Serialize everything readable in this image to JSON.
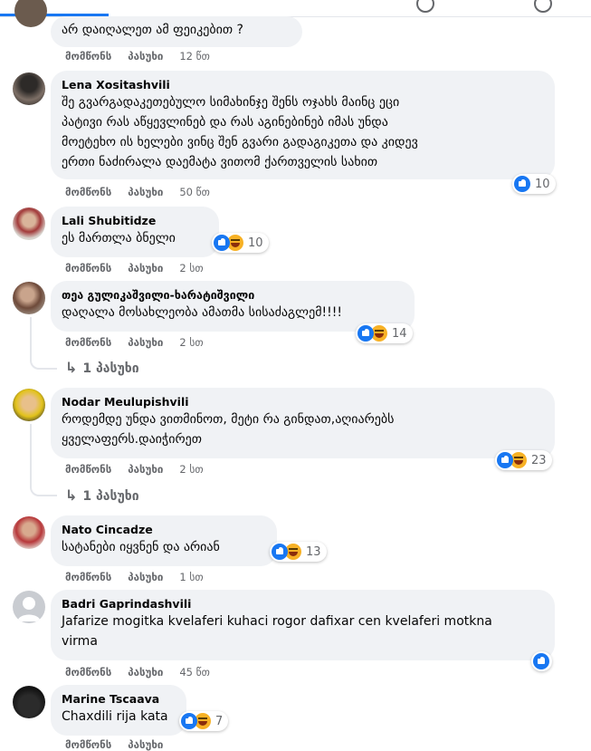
{
  "colors": {
    "accent": "#1877f2",
    "bubble": "#f0f2f5",
    "meta": "#65676b"
  },
  "labels": {
    "like": "მომწონს",
    "reply": "პასუხი"
  },
  "comments": [
    {
      "name": "",
      "text": "არ დაიღალეთ ამ ფეიკებით ?",
      "time": "12 წთ",
      "reactions": null
    },
    {
      "name": "Lena Xositashvili",
      "text": "შე გვარგადაკეთებულო სიმახინჯე შენს ოჯახს მაინც ეცი\nპატივი რას აწყევლინებ და რას აგინებინებ იმას უნდა\nმოეტეხო ის ხელები ვინც შენ გვარი გადაგიკეთა და კიდევ\nერთი ნაძირალა დაემატა ვითომ ქართველის სახით",
      "time": "50 წთ",
      "reactions": {
        "icons": [
          "like"
        ],
        "count": "10"
      }
    },
    {
      "name": "Lali Shubitidze",
      "text": "ეს მართლა ბნელი",
      "time": "2 სთ",
      "reactions": {
        "icons": [
          "like",
          "haha"
        ],
        "count": "10"
      }
    },
    {
      "name": "თეა გულიკაშვილი-ხარატიშვილი",
      "text": "დაღალა მოსახლეობა ამათმა სისაძაგლემ!!!!",
      "time": "2 სთ",
      "reactions": {
        "icons": [
          "like",
          "haha"
        ],
        "count": "14"
      },
      "replies": "1 პასუხი"
    },
    {
      "name": "Nodar Meulupishvili",
      "text": "როდემდე უნდა ვითმინოთ, მეტი რა გინდათ,აღიარებს\nყველაფერს.დაიჭირეთ",
      "time": "2 სთ",
      "reactions": {
        "icons": [
          "like",
          "haha"
        ],
        "count": "23"
      },
      "replies": "1 პასუხი"
    },
    {
      "name": "Nato Cincadze",
      "text": "სატანები იყვნენ და არიან",
      "time": "1 სთ",
      "reactions": {
        "icons": [
          "like",
          "haha"
        ],
        "count": "13"
      }
    },
    {
      "name": "Badri Gaprindashvili",
      "text": "Jafarize mogitka kvelaferi kuhaci rogor dafixar cen kvelaferi motkna\nvirma",
      "time": "45 წთ",
      "reactions": {
        "icons": [
          "like"
        ],
        "count": ""
      }
    },
    {
      "name": "Marine Tscaava",
      "text": "Chaxdili rija kata",
      "time": "",
      "reactions": {
        "icons": [
          "like",
          "haha"
        ],
        "count": "7"
      }
    }
  ]
}
